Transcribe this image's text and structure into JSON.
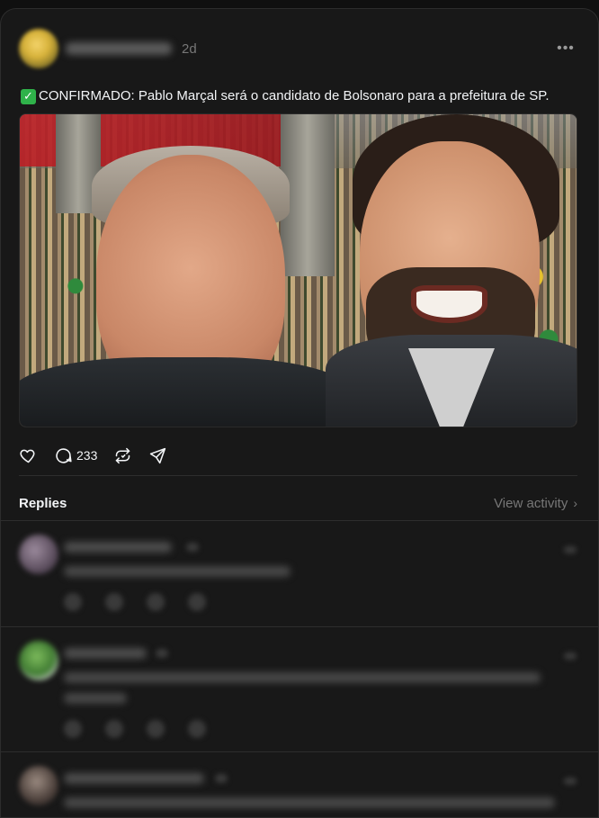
{
  "post": {
    "author": "username",
    "time": "2d",
    "text_prefix_icon": "check-mark-button-icon",
    "text": "CONFIRMADO: Pablo Marçal será o candidato de Bolsonaro para a prefeitura de SP.",
    "image_alt": "Selfie of two men in front of a crowd"
  },
  "actions": {
    "like_icon": "heart-icon",
    "reply_icon": "comment-icon",
    "reply_count": "233",
    "repost_icon": "repost-icon",
    "share_icon": "send-icon"
  },
  "replies_section": {
    "title": "Replies",
    "view_activity_label": "View activity",
    "chevron": "›"
  },
  "colors": {
    "background": "#101010",
    "panel": "#181818",
    "text": "#f3f5f7",
    "muted": "#777777",
    "check_green": "#2fb24a"
  }
}
